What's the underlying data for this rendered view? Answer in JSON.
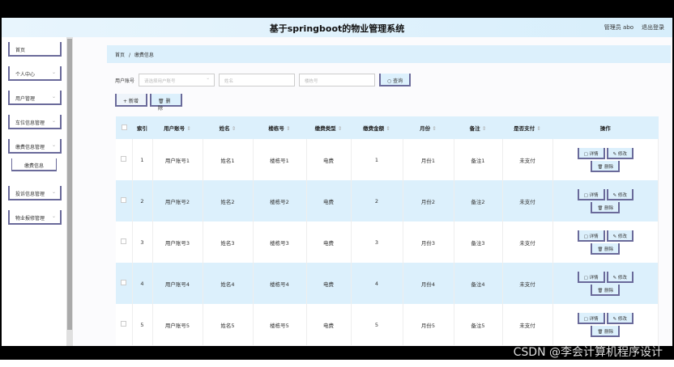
{
  "header": {
    "title": "基于springboot的物业管理系统",
    "user": "管理员 abo",
    "logout": "退出登录"
  },
  "sidebar": {
    "items": [
      {
        "label": "首页"
      },
      {
        "label": "个人中心"
      },
      {
        "label": "用户管理"
      },
      {
        "label": "车位信息管理"
      },
      {
        "label": "缴费信息管理"
      },
      {
        "label": "投诉信息管理"
      },
      {
        "label": "物业报修管理"
      }
    ],
    "sub": "缴费信息"
  },
  "breadcrumb": {
    "home": "首页",
    "sep": "/",
    "current": "缴费信息"
  },
  "search": {
    "label": "用户账号",
    "account_placeholder": "请选择用户账号",
    "name_placeholder": "姓名",
    "building_placeholder": "楼栋号",
    "query": "查询"
  },
  "actions": {
    "add": "+ 新增",
    "delete": "🗑 删除"
  },
  "table": {
    "headers": [
      "索引",
      "用户账号",
      "姓名",
      "楼栋号",
      "缴费类型",
      "缴费金额",
      "月份",
      "备注",
      "是否支付",
      "操作"
    ],
    "rows": [
      [
        "1",
        "用户账号1",
        "姓名1",
        "楼栋号1",
        "电费",
        "1",
        "月份1",
        "备注1",
        "未支付"
      ],
      [
        "2",
        "用户账号2",
        "姓名2",
        "楼栋号2",
        "电费",
        "2",
        "月份2",
        "备注2",
        "未支付"
      ],
      [
        "3",
        "用户账号3",
        "姓名3",
        "楼栋号3",
        "电费",
        "3",
        "月份3",
        "备注3",
        "未支付"
      ],
      [
        "4",
        "用户账号4",
        "姓名4",
        "楼栋号4",
        "电费",
        "4",
        "月份4",
        "备注4",
        "未支付"
      ],
      [
        "5",
        "用户账号5",
        "姓名5",
        "楼栋号5",
        "电费",
        "5",
        "月份5",
        "备注5",
        "未支付"
      ]
    ],
    "ops": {
      "detail": "▢ 详情",
      "edit": "✎ 修改",
      "delete": "🗑 删除"
    }
  },
  "watermark": "CSDN @李会计算机程序设计"
}
